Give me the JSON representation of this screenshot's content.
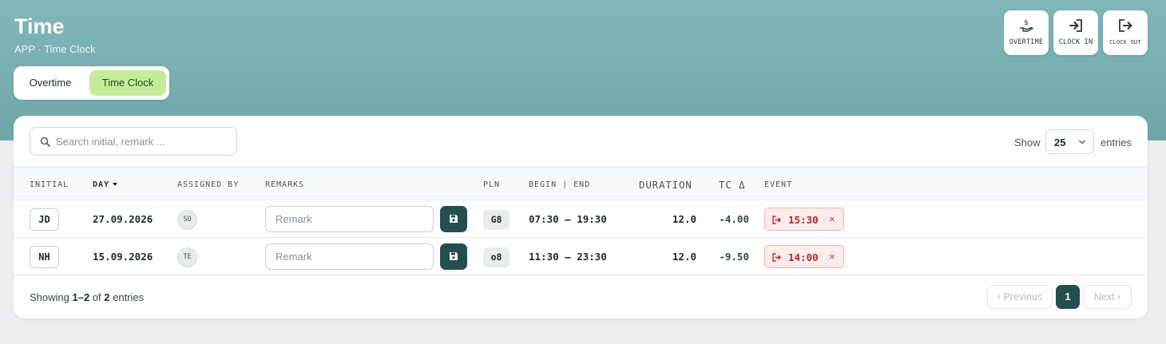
{
  "header": {
    "title": "Time",
    "subtitle": "APP · Time Clock",
    "tabs": [
      {
        "label": "Overtime",
        "active": false
      },
      {
        "label": "Time Clock",
        "active": true
      }
    ],
    "actions": [
      {
        "label": "OVERTIME",
        "icon": "hand-dollar-icon"
      },
      {
        "label": "CLOCK IN",
        "icon": "sign-in-icon"
      },
      {
        "label": "CLOCK OUT",
        "icon": "sign-out-icon"
      }
    ]
  },
  "toolbar": {
    "search_placeholder": "Search initial, remark ...",
    "show_label": "Show",
    "entries_value": "25",
    "entries_label": "entries"
  },
  "table": {
    "columns": {
      "initial": "INITIAL",
      "day": "DAY",
      "assigned_by": "ASSIGNED BY",
      "remarks": "REMARKS",
      "pln": "PLN",
      "begin_end": "BEGIN | END",
      "duration": "DURATION",
      "tc_delta": "TC Δ",
      "event": "EVENT"
    },
    "rows": [
      {
        "initial": "JD",
        "day": "27.09.2026",
        "assigned_by": "SO",
        "remark_placeholder": "Remark",
        "pln": "G8",
        "begin_end": "07:30 – 19:30",
        "duration": "12.0",
        "tc_delta": "-4.00",
        "event_time": "15:30",
        "event_close": "×"
      },
      {
        "initial": "NH",
        "day": "15.09.2026",
        "assigned_by": "TE",
        "remark_placeholder": "Remark",
        "pln": "o8",
        "begin_end": "11:30 – 23:30",
        "duration": "12.0",
        "tc_delta": "-9.50",
        "event_time": "14:00",
        "event_close": "×"
      }
    ]
  },
  "footer": {
    "showing_prefix": "Showing ",
    "showing_range": "1–2",
    "showing_mid": " of ",
    "showing_total": "2",
    "showing_suffix": " entries",
    "prev_label": "Previous",
    "page": "1",
    "next_label": "Next"
  },
  "colors": {
    "header_bg": "#7fb6b8",
    "accent_dark": "#234f4e",
    "active_tab": "#c5ec9a",
    "event_red": "#b3262a"
  }
}
